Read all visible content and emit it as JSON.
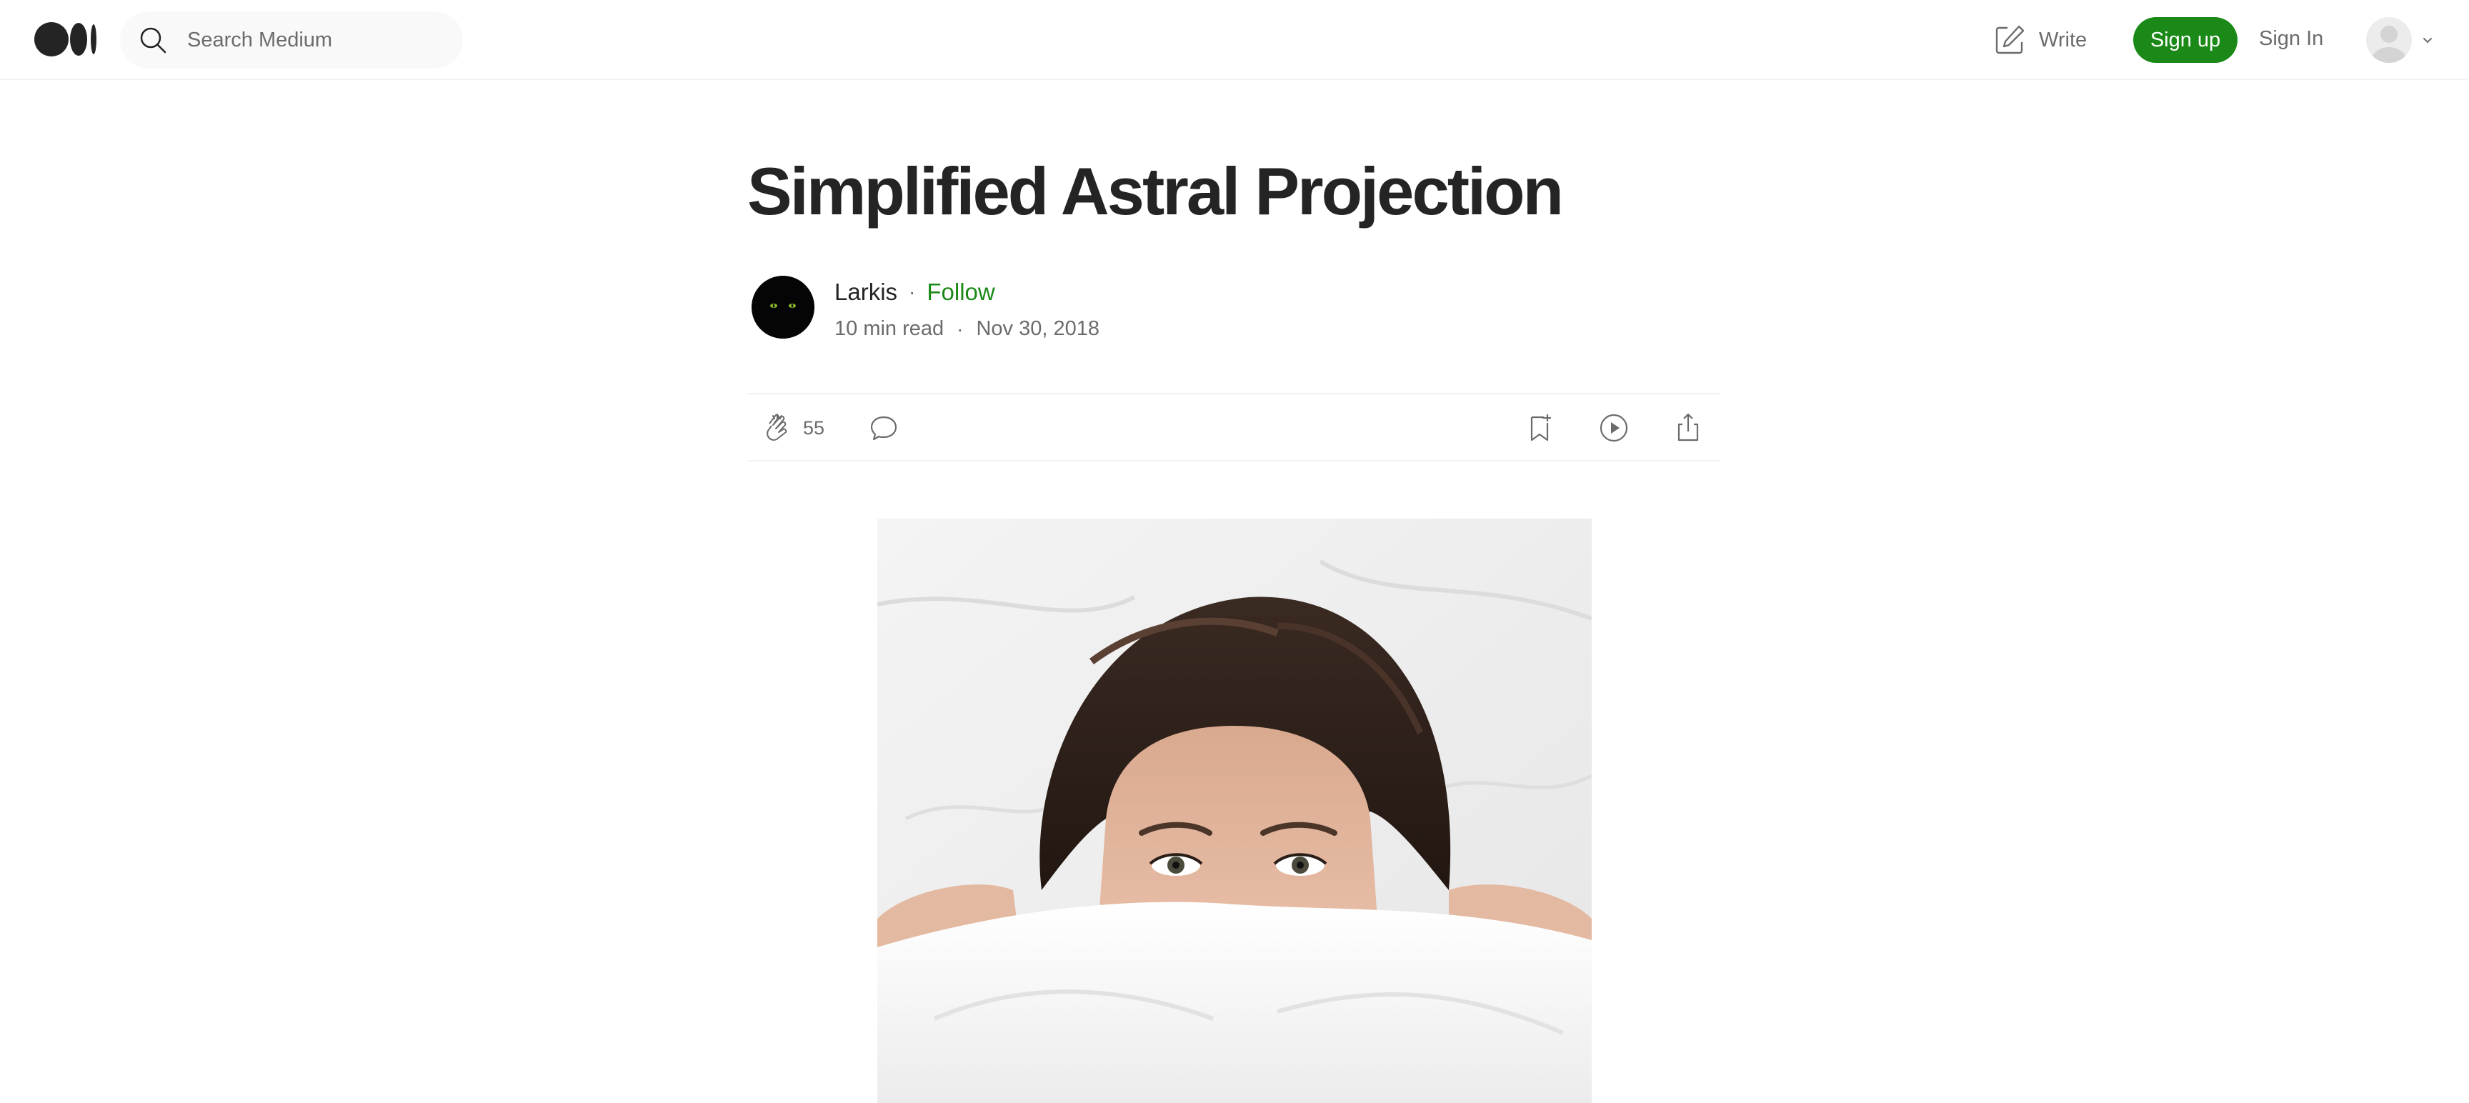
{
  "header": {
    "logo_icon": "medium-logo-icon",
    "search": {
      "placeholder": "Search Medium",
      "value": "",
      "icon": "search-icon"
    },
    "write": {
      "label": "Write",
      "icon": "write-icon"
    },
    "signup_label": "Sign up",
    "signin_label": "Sign In",
    "profile": {
      "icon": "user-avatar-icon",
      "menu_icon": "chevron-down-icon"
    }
  },
  "article": {
    "title": "Simplified Astral Projection",
    "author": {
      "name": "Larkis",
      "follow_label": "Follow",
      "separator": "·"
    },
    "meta": {
      "read_time": "10 min read",
      "separator": "·",
      "date": "Nov 30, 2018"
    },
    "actions": {
      "clap_icon": "clap-icon",
      "clap_count": "55",
      "comment_icon": "comment-icon",
      "bookmark_icon": "bookmark-add-icon",
      "listen_icon": "play-icon",
      "share_icon": "share-icon"
    },
    "hero_image": {
      "description_icon": "hero-image"
    }
  },
  "colors": {
    "brand_green": "#1a8917",
    "text_primary": "#242424",
    "text_secondary": "#6b6b6b",
    "divider": "#f2f2f2",
    "search_bg": "#f9f9f9"
  }
}
